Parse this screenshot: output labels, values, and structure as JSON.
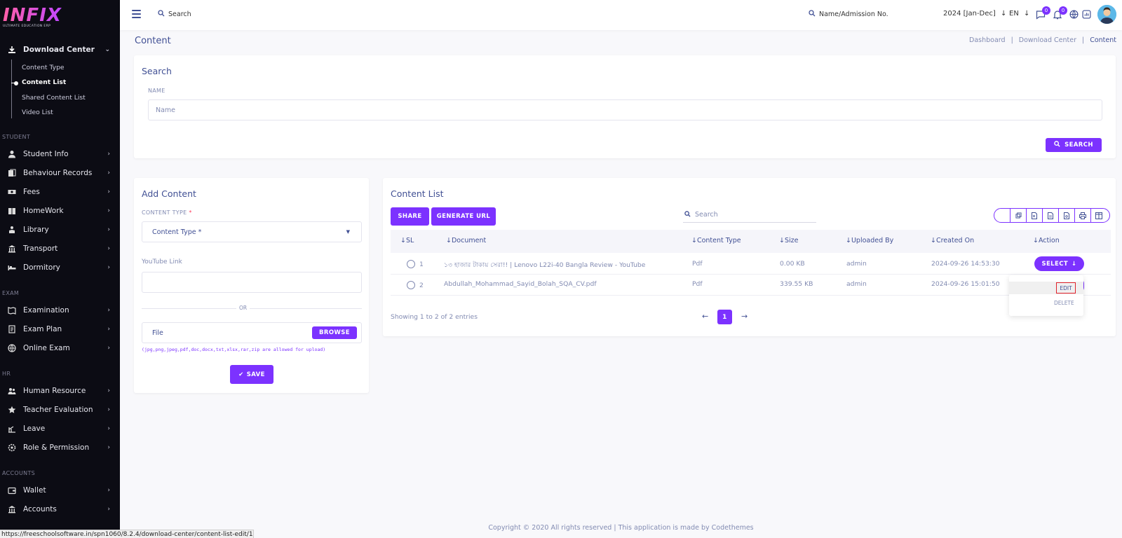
{
  "sidebar": {
    "logo_text": "INFIX",
    "logo_subtext": "ULTIMATE EDUCATION ERP",
    "download_center": {
      "label": "Download Center",
      "icon": "download-icon",
      "children": [
        "Content Type",
        "Content List",
        "Shared Content List",
        "Video List"
      ],
      "active": "Content List"
    },
    "sections": [
      {
        "label": "STUDENT",
        "items": [
          {
            "label": "Student Info",
            "icon": "user-icon"
          },
          {
            "label": "Behaviour Records",
            "icon": "records-icon"
          },
          {
            "label": "Fees",
            "icon": "money-icon"
          },
          {
            "label": "HomeWork",
            "icon": "book-icon"
          },
          {
            "label": "Library",
            "icon": "library-icon"
          },
          {
            "label": "Transport",
            "icon": "transport-icon"
          },
          {
            "label": "Dormitory",
            "icon": "bed-icon"
          }
        ]
      },
      {
        "label": "EXAM",
        "items": [
          {
            "label": "Examination",
            "icon": "map-icon"
          },
          {
            "label": "Exam Plan",
            "icon": "plan-icon"
          },
          {
            "label": "Online Exam",
            "icon": "globe-icon"
          }
        ]
      },
      {
        "label": "HR",
        "items": [
          {
            "label": "Human Resource",
            "icon": "people-icon"
          },
          {
            "label": "Teacher Evaluation",
            "icon": "star-icon"
          },
          {
            "label": "Leave",
            "icon": "leave-icon"
          },
          {
            "label": "Role & Permission",
            "icon": "settings-icon"
          }
        ]
      },
      {
        "label": "ACCOUNTS",
        "items": [
          {
            "label": "Wallet",
            "icon": "wallet-icon"
          },
          {
            "label": "Accounts",
            "icon": "bank-icon"
          }
        ]
      }
    ],
    "status_url": "https://freeschoolsoftware.in/spn1060/8.2.4/download-center/content-list-edit/1"
  },
  "topbar": {
    "search_placeholder": "Search",
    "admission_placeholder": "Name/Admission No.",
    "year": "2024 [Jan-Dec]",
    "language": "EN",
    "message_count": "0",
    "notification_count": "0"
  },
  "page": {
    "title": "Content",
    "breadcrumb": [
      "Dashboard",
      "Download Center",
      "Content"
    ]
  },
  "search_card": {
    "title": "Search",
    "name_label": "NAME",
    "name_placeholder": "Name",
    "search_button": "SEARCH"
  },
  "add_content": {
    "title": "Add Content",
    "content_type_label": "CONTENT TYPE",
    "required_mark": "*",
    "content_type_placeholder": "Content Type *",
    "youtube_label": "YouTube Link",
    "youtube_value": "",
    "or_text": "OR",
    "file_placeholder": "File",
    "browse_button": "BROWSE",
    "allowed_text": "(jpg,png,jpeg,pdf,doc,docx,txt,xlsx,rar,zip are allowed for upload)",
    "save_button": "SAVE"
  },
  "content_list": {
    "title": "Content List",
    "share_button": "SHARE",
    "generate_url_button": "GENERATE URL",
    "search_placeholder": "Search",
    "columns": [
      "SL",
      "Document",
      "Content Type",
      "Size",
      "Uploaded By",
      "Created On",
      "Action"
    ],
    "rows": [
      {
        "sl": "1",
        "document": "১৩ হাজার টাকায় সেরা!! | Lenovo L22i-40 Bangla Review - YouTube",
        "type": "Pdf",
        "size": "0.00 KB",
        "uploaded_by": "admin",
        "created_on": "2024-09-26 14:53:30"
      },
      {
        "sl": "2",
        "document": "Abdullah_Mohammad_Sayid_Bolah_SQA_CV.pdf",
        "type": "Pdf",
        "size": "339.55 KB",
        "uploaded_by": "admin",
        "created_on": "2024-09-26 15:01:50"
      }
    ],
    "select_button": "SELECT",
    "dropdown": {
      "edit": "EDIT",
      "delete": "DELETE"
    },
    "showing_text": "Showing 1 to 2 of 2 entries",
    "current_page": "1",
    "accent_color": "#7c32ff"
  },
  "footer": {
    "text": "Copyright © 2020 All rights reserved | This application is made by Codethemes"
  }
}
